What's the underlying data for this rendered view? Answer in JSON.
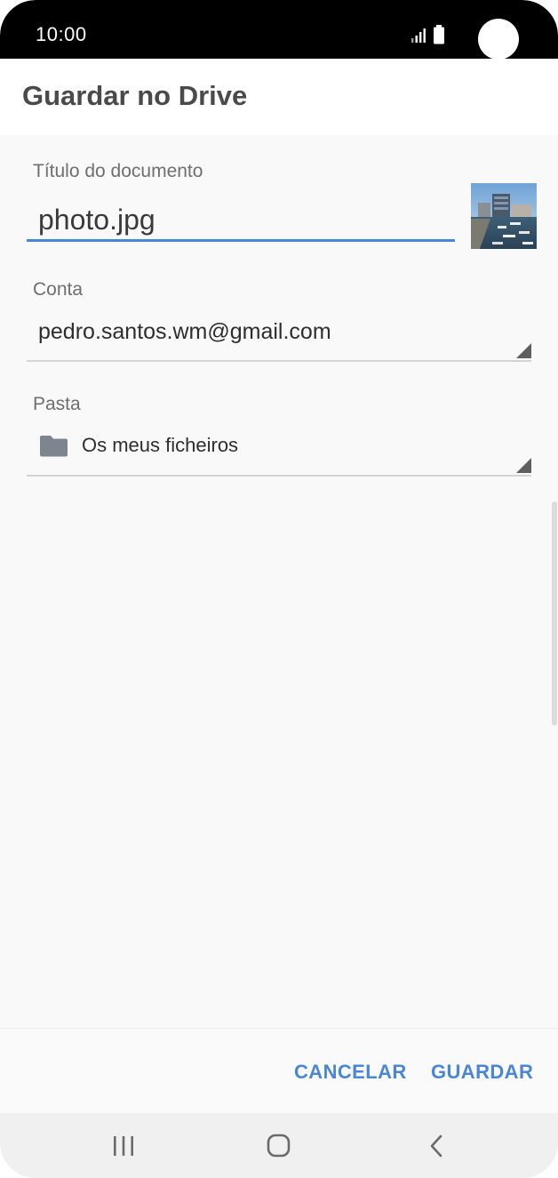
{
  "status_bar": {
    "time": "10:00",
    "icons": [
      "signal-icon",
      "battery-icon"
    ]
  },
  "header": {
    "title": "Guardar no Drive"
  },
  "form": {
    "title_label": "Título do documento",
    "title_value": "photo.jpg",
    "thumbnail": "photo-thumbnail",
    "account_label": "Conta",
    "account_value": "pedro.santos.wm@gmail.com",
    "folder_label": "Pasta",
    "folder_icon": "folder-icon",
    "folder_value": "Os meus ficheiros"
  },
  "actions": {
    "cancel_label": "CANCELAR",
    "save_label": "GUARDAR"
  },
  "nav_bar": {
    "icons": [
      "recent-apps-icon",
      "home-icon",
      "back-icon"
    ]
  },
  "colors": {
    "accent": "#4a86d8",
    "title_text": "#4a4a4a",
    "status_bar": "#000000",
    "background": "#f9f9f9"
  }
}
